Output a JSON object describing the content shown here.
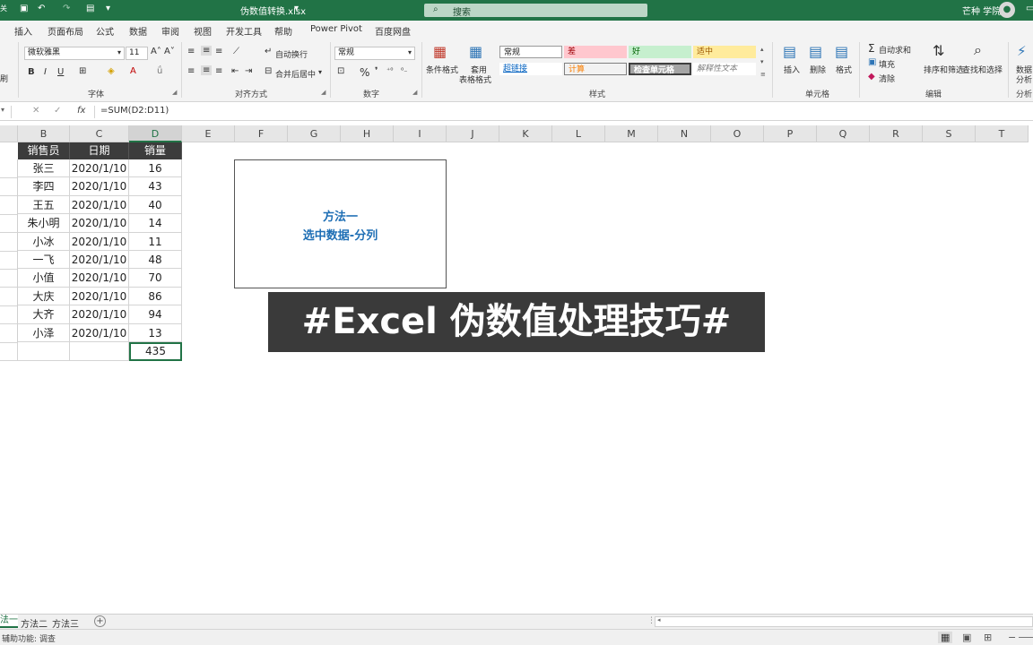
{
  "titlebar": {
    "filename": "伪数值转换.xlsx",
    "search_placeholder": "搜索",
    "user": "芒种 学院"
  },
  "menu": [
    "插入",
    "页面布局",
    "公式",
    "数据",
    "审阅",
    "视图",
    "开发工具",
    "帮助",
    "Power Pivot",
    "百度网盘"
  ],
  "ribbon": {
    "font_name": "微软雅黑",
    "font_size": "11",
    "font_group": "字体",
    "align_group": "对齐方式",
    "wrap_text": "自动换行",
    "merge_center": "合并后居中",
    "number_format": "常规",
    "number_group": "数字",
    "cond_format": "条件格式",
    "table_format_1": "套用",
    "table_format_2": "表格格式",
    "styles": [
      {
        "label": "常规",
        "bg": "#ffffff",
        "fg": "#222222"
      },
      {
        "label": "差",
        "bg": "#ffc7ce",
        "fg": "#9c0006"
      },
      {
        "label": "好",
        "bg": "#c6efce",
        "fg": "#006100"
      },
      {
        "label": "适中",
        "bg": "#ffeb9c",
        "fg": "#9c5700"
      },
      {
        "label": "超链接",
        "bg": "#ffffff",
        "fg": "#0563c1"
      },
      {
        "label": "计算",
        "bg": "#f2f2f2",
        "fg": "#fa7d00"
      },
      {
        "label": "检查单元格",
        "bg": "#a5a5a5",
        "fg": "#ffffff"
      },
      {
        "label": "解释性文本",
        "bg": "#ffffff",
        "fg": "#7f7f7f"
      }
    ],
    "styles_group": "样式",
    "insert": "插入",
    "delete": "删除",
    "format": "格式",
    "cells_group": "单元格",
    "autosum": "自动求和",
    "fill": "填充",
    "clear": "清除",
    "sort_filter": "排序和筛选",
    "find_select": "查找和选择",
    "editing_group": "编辑",
    "analyze_1": "数据",
    "analyze_2": "分析",
    "analyze_group": "分析"
  },
  "formula_bar": {
    "fx": "fx",
    "formula": "=SUM(D2:D11)"
  },
  "columns": [
    "B",
    "C",
    "D",
    "E",
    "F",
    "G",
    "H",
    "I",
    "J",
    "K",
    "L",
    "M",
    "N",
    "O",
    "P",
    "Q",
    "R",
    "S",
    "T"
  ],
  "table": {
    "headers": [
      "销售员",
      "日期",
      "销量"
    ],
    "rows": [
      [
        "张三",
        "2020/1/10",
        "16"
      ],
      [
        "李四",
        "2020/1/10",
        "43"
      ],
      [
        "王五",
        "2020/1/10",
        "40"
      ],
      [
        "朱小明",
        "2020/1/10",
        "14"
      ],
      [
        "小冰",
        "2020/1/10",
        "11"
      ],
      [
        "一飞",
        "2020/1/10",
        "48"
      ],
      [
        "小值",
        "2020/1/10",
        "70"
      ],
      [
        "大庆",
        "2020/1/10",
        "86"
      ],
      [
        "大齐",
        "2020/1/10",
        "94"
      ],
      [
        "小泽",
        "2020/1/10",
        "13"
      ]
    ],
    "total": "435"
  },
  "method_box": {
    "line1": "方法一",
    "line2": "选中数据-分列"
  },
  "banner": "#Excel 伪数值处理技巧#",
  "sheets": [
    "法一",
    "方法二",
    "方法三"
  ],
  "status_text": "辅助功能: 调查",
  "colors": {
    "excel_green": "#217346",
    "selected_green": "#217346",
    "header_dark": "#3c3c3c",
    "method_blue": "#1f6fb5"
  }
}
